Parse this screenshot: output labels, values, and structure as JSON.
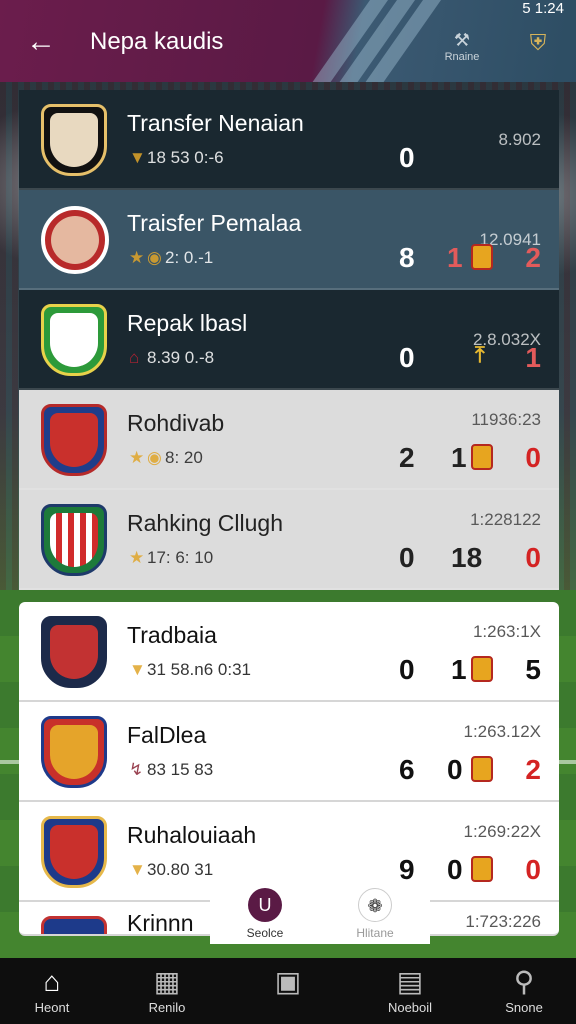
{
  "status_bar": {
    "time": "5 1:24"
  },
  "header": {
    "title": "Nepa kaudis",
    "right_icon_label": "Rnaine"
  },
  "rows": [
    {
      "name": "Transfer Nenaian",
      "meta": "18 53 0:-6",
      "time": "8.902",
      "scores": [
        "0"
      ],
      "style": "dark"
    },
    {
      "name": "Traisfer Pemalaa",
      "meta": "2: 0.-1",
      "time": "12.0941",
      "scores": [
        "8",
        "1",
        "2"
      ],
      "style": "alt"
    },
    {
      "name": "Repak lbasl",
      "meta": "8.39 0.-8",
      "time": "2.8.032X",
      "scores": [
        "0",
        "1"
      ],
      "style": "dark"
    },
    {
      "name": "Rohdivab",
      "meta": "8: 20",
      "time": "11936:23",
      "scores": [
        "2",
        "1",
        "0"
      ],
      "style": "grey"
    },
    {
      "name": "Rahking Cllugh",
      "meta": "17: 6: 10",
      "time": "1:228122",
      "scores": [
        "0",
        "18",
        "0"
      ],
      "style": "grey"
    },
    {
      "name": "Tradbaia",
      "meta": "31 58.n6 0:31",
      "time": "1:263:1X",
      "scores": [
        "0",
        "1",
        "5"
      ],
      "style": "light"
    },
    {
      "name": "FalDlea",
      "meta": "83 15 83",
      "time": "1:263.12X",
      "scores": [
        "6",
        "0",
        "2"
      ],
      "style": "light"
    },
    {
      "name": "Ruhalouiaah",
      "meta": "30.80 31",
      "time": "1:269:22X",
      "scores": [
        "9",
        "0",
        "0"
      ],
      "style": "light"
    },
    {
      "name": "Krinnn",
      "meta": "",
      "time": "1:723:226",
      "scores": [],
      "style": "light"
    }
  ],
  "mid_tabs": [
    {
      "label": "Seolce",
      "icon": "u-logo-icon"
    },
    {
      "label": "Hlitane",
      "icon": "leaf-icon"
    }
  ],
  "nav": [
    {
      "label": "Heont",
      "icon": "home-icon"
    },
    {
      "label": "Renilo",
      "icon": "box-icon"
    },
    {
      "label": "",
      "icon": "book-icon"
    },
    {
      "label": "Noeboil",
      "icon": "window-icon"
    },
    {
      "label": "Snone",
      "icon": "search-icon"
    }
  ]
}
